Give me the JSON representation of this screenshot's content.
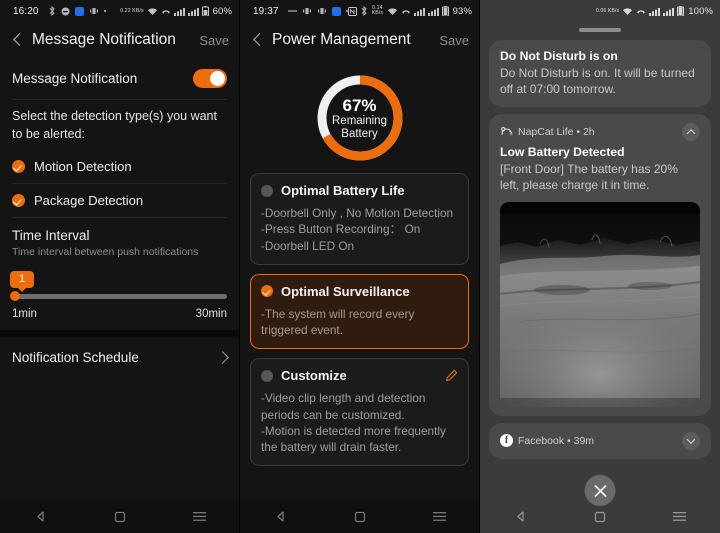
{
  "screen_left": {
    "status_bar": {
      "time": "16:20",
      "left_icons": [
        "bluetooth-icon",
        "dnd-icon",
        "camera-icon",
        "vibrate-icon",
        "dot-icon"
      ],
      "data_rate": "0.22 KB/s",
      "right_icons": [
        "wifi-icon",
        "missed-call-icon",
        "signal-icon",
        "signal-icon"
      ],
      "battery": "60%"
    },
    "appbar": {
      "back": "back-icon",
      "title": "Message Notification",
      "action": "Save"
    },
    "toggle_row": {
      "label": "Message Notification",
      "state": "on"
    },
    "helper_text": "Select the detection type(s) you want to be alerted:",
    "detection_types": [
      {
        "label": "Motion Detection",
        "checked": true
      },
      {
        "label": "Package Detection",
        "checked": true
      }
    ],
    "time_interval": {
      "title": "Time Interval",
      "subtitle": "Time interval between push notifications",
      "value": "1",
      "min_label": "1min",
      "max_label": "30min",
      "percent": 0
    },
    "notification_schedule": {
      "label": "Notification Schedule",
      "chevron": "chevron-right-icon"
    },
    "nav": [
      "back-nav-icon",
      "home-nav-icon",
      "recents-nav-icon"
    ]
  },
  "screen_mid": {
    "status_bar": {
      "time": "19:37",
      "left_icons": [
        "dash-icon",
        "vibrate-icon",
        "vibrate-icon",
        "camera-icon",
        "dot-icon"
      ],
      "data_rate": "0.14 KB/s",
      "right_icons": [
        "nfc-icon",
        "bluetooth-icon",
        "wifi-icon",
        "missed-call-icon",
        "signal-icon",
        "signal-icon"
      ],
      "battery": "93%"
    },
    "appbar": {
      "back": "back-icon",
      "title": "Power Management",
      "action": "Save"
    },
    "battery_ring": {
      "percent_label": "67%",
      "line1": "Remaining",
      "line2": "Battery",
      "percent": 67,
      "arc_color": "#ed6c0b",
      "track_color": "#f0f0f0"
    },
    "modes": [
      {
        "title": "Optimal Battery Life",
        "selected": false,
        "lines": [
          "-Doorbell Only ,  No Motion Detection",
          "-Press Button Recording：  On",
          "-Doorbell LED On"
        ]
      },
      {
        "title": "Optimal Surveillance",
        "selected": true,
        "lines": [
          "-The system will record every triggered event."
        ]
      },
      {
        "title": "Customize",
        "selected": false,
        "edit_icon": "pencil-icon",
        "lines": [
          "-Video clip length and detection periods can be customized.",
          "-Motion is detected more frequently the battery will drain faster."
        ]
      }
    ],
    "nav": [
      "back-nav-icon",
      "home-nav-icon",
      "recents-nav-icon"
    ]
  },
  "screen_right": {
    "status_bar": {
      "data_rate": "0.06 KB/s",
      "right_icons": [
        "wifi-icon",
        "missed-call-icon",
        "signal-icon",
        "signal-icon"
      ],
      "battery": "100%"
    },
    "notifications": [
      {
        "title": "Do Not Disturb is on",
        "body": "Do Not Disturb is on. It will be turned off at 07:00 tomorrow."
      },
      {
        "app": "NapCat Life • 2h",
        "app_icon": "napcat-icon",
        "collapse_icon": "chevron-up-icon",
        "title": "Low Battery Detected",
        "body": "[Front Door] The battery has 20% left, please charge it in time.",
        "image": "night-vision-camera-snapshot"
      },
      {
        "app": "Facebook • 39m",
        "app_icon": "facebook-icon",
        "expand_icon": "chevron-down-icon"
      }
    ],
    "close_button": "close-icon",
    "nav": [
      "back-nav-icon",
      "home-nav-icon",
      "recents-nav-icon"
    ]
  },
  "theme": {
    "accent": "#ed6c0b",
    "panel_bg": "#141414",
    "shade_bg": "#3b3b3b",
    "notif_bg": "#4a4a4a",
    "card_bg": "#1b1b1b",
    "card_selected_bg": "#301c0f"
  }
}
